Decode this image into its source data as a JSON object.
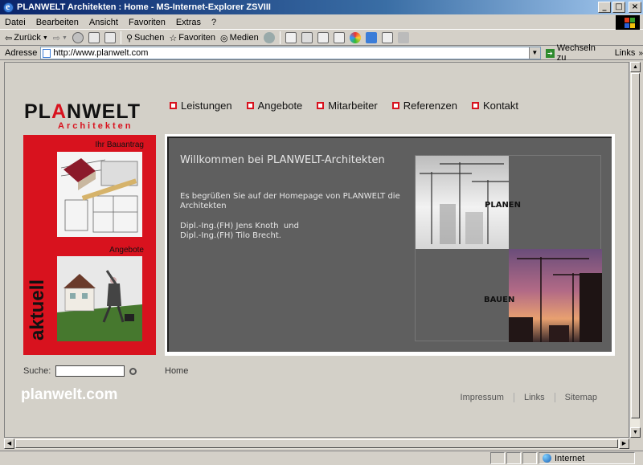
{
  "window": {
    "title": "PLANWELT Architekten : Home - MS-Internet-Explorer ZSVIII"
  },
  "menu": [
    "Datei",
    "Bearbeiten",
    "Ansicht",
    "Favoriten",
    "Extras",
    "?"
  ],
  "toolbar": {
    "back": "Zurück",
    "search": "Suchen",
    "favorites": "Favoriten",
    "media": "Medien"
  },
  "address": {
    "label": "Adresse",
    "url": "http://www.planwelt.com",
    "go": "Wechseln zu",
    "links": "Links"
  },
  "status": {
    "zone": "Internet"
  },
  "page": {
    "logo_main_1": "PL",
    "logo_main_a": "A",
    "logo_main_2": "NWELT",
    "logo_sub": "Architekten",
    "nav": [
      "Leistungen",
      "Angebote",
      "Mitarbeiter",
      "Referenzen",
      "Kontakt"
    ],
    "side_label_1": "Ihr Bauantrag",
    "side_label_2": "Angebote",
    "side_vertical": "aktuell",
    "welcome_title": "Willkommen bei PLANWELT-Architekten",
    "welcome_text": "Es begrüßen Sie auf der Homepage von PLANWELT die Architekten",
    "names": "Dipl.-Ing.(FH) Jens Knoth  und\nDipl.-Ing.(FH) Tilo Brecht.",
    "collage_plan": "PLANEN",
    "collage_bau": "BAUEN",
    "search_label": "Suche:",
    "breadcrumb": "Home",
    "footer_brand": "planwelt.com",
    "footer_links": [
      "Impressum",
      "Links",
      "Sitemap"
    ]
  },
  "colors": {
    "accent": "#d8121e",
    "content_bg": "#5f5f5f",
    "titlebar": "#0a246a"
  }
}
